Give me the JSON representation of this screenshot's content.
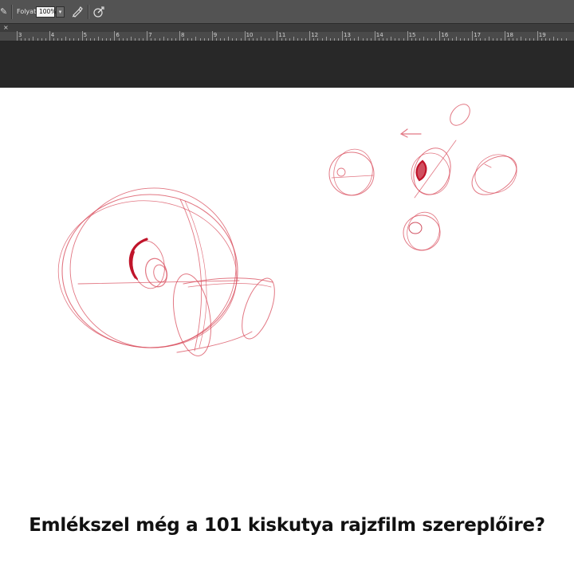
{
  "options_bar": {
    "flow_label": "Folyat:",
    "flow_value": "100%",
    "dropdown_arrow": "▾",
    "icons": [
      "brush-tool-icon",
      "airbrush-icon",
      "pressure-size-icon"
    ]
  },
  "document_tab": {
    "close_symbol": "×"
  },
  "ruler": {
    "labels": [
      "3",
      "4",
      "5",
      "6",
      "7",
      "8",
      "9",
      "10",
      "11",
      "12",
      "13",
      "14",
      "15",
      "16",
      "17",
      "18",
      "19"
    ]
  },
  "caption": {
    "text": "Emlékszel még a 101 kiskutya rajzfilm szereplőire?"
  },
  "colors": {
    "sketch_red": "#d84a5a",
    "sketch_dark_red": "#c0142a",
    "ui_dark": "#282828",
    "ui_panel": "#535353"
  }
}
